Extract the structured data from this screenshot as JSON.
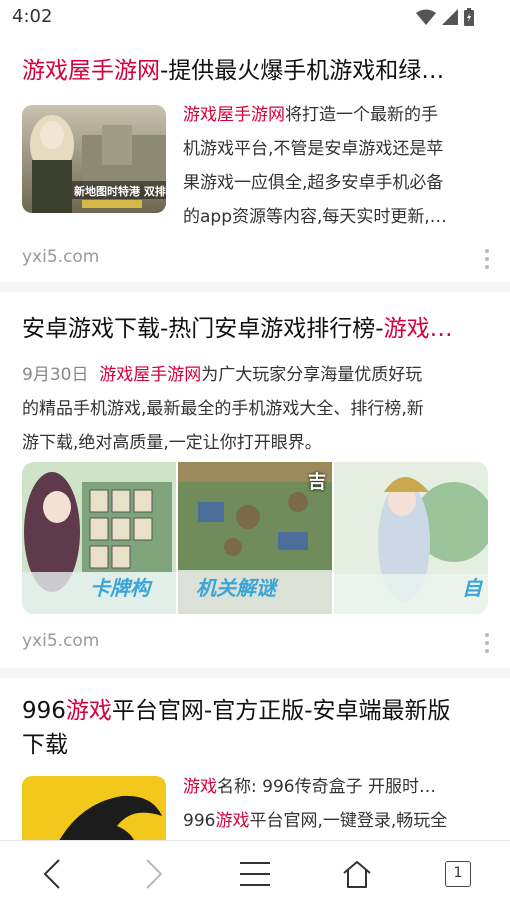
{
  "status": {
    "time": "4:02"
  },
  "results": [
    {
      "title_hl": "游戏屋手游网",
      "title_rest": "-提供最火爆手机游戏和绿…",
      "snippet_hl": "游戏屋手游网",
      "snippet_rest_1": "将打造一个最新的手",
      "snippet_line_2": "机游戏平台,不管是安卓游戏还是苹",
      "snippet_line_3": "果游戏一应俱全,超多安卓手机必备",
      "snippet_line_4": "的app资源等内容,每天实时更新,…",
      "thumb_caption": "新地图时特港 双排",
      "domain": "yxi5.com"
    },
    {
      "title_rest": "安卓游戏下载-热门安卓游戏排行榜-",
      "title_hl": "游戏…",
      "date": "9月30日",
      "snippet_hl": "游戏屋手游网",
      "snippet_rest_1": "为广大玩家分享海量优质好玩",
      "snippet_line_2": "的精品手机游戏,最新最全的手机游戏大全、排行榜,新",
      "snippet_line_3": "游下载,绝对高质量,一定让你打开眼界。",
      "image_captions": [
        "卡牌构",
        "机关解谜",
        "自"
      ],
      "domain": "yxi5.com"
    },
    {
      "title_pre": "996",
      "title_hl": "游戏",
      "title_rest": "平台官网-官方正版-安卓端最新版",
      "title_line_2": "下载",
      "info_hl": "游戏",
      "info_rest": "名称: 996传奇盒子    开服时…",
      "snippet_pre": "996",
      "snippet_hl": "游戏",
      "snippet_rest": "平台官网,一键登录,畅玩全"
    }
  ],
  "navbar": {
    "tab_count": "1"
  },
  "colors": {
    "highlight": "#d8003c",
    "separator": "#f4f5f7"
  },
  "icons": [
    "wifi-icon",
    "signal-icon",
    "battery-icon",
    "back-icon",
    "forward-icon",
    "menu-icon",
    "home-icon",
    "tabs-icon",
    "more-vert-icon"
  ]
}
